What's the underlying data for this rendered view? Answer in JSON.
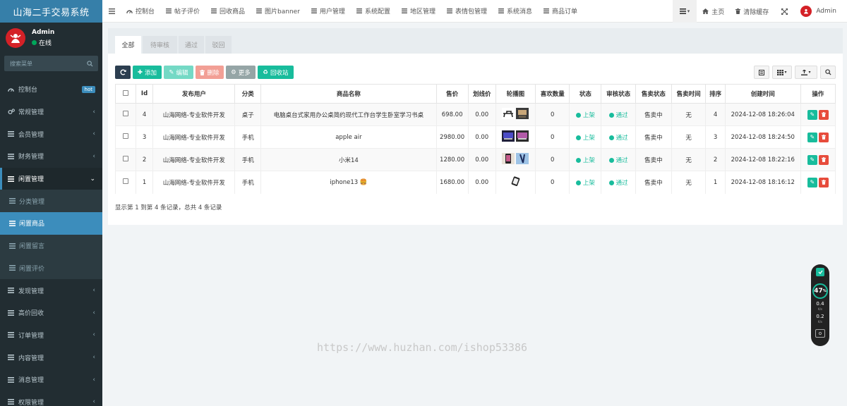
{
  "app": {
    "title": "山海二手交易系统"
  },
  "user": {
    "name": "Admin",
    "status": "在线"
  },
  "search": {
    "placeholder": "搜索菜单"
  },
  "sidebar": {
    "items": [
      {
        "label": "控制台",
        "badge": "hot",
        "icon": "dashboard-icon"
      },
      {
        "label": "常规管理",
        "icon": "cogs-icon"
      },
      {
        "label": "会员管理",
        "icon": "list-icon"
      },
      {
        "label": "财务管理",
        "icon": "list-icon"
      },
      {
        "label": "闲置管理",
        "icon": "list-icon",
        "open": true,
        "children": [
          {
            "label": "分类管理"
          },
          {
            "label": "闲置商品",
            "active": true
          },
          {
            "label": "闲置留言"
          },
          {
            "label": "闲置评价"
          }
        ]
      },
      {
        "label": "发现管理",
        "icon": "list-icon"
      },
      {
        "label": "高价回收",
        "icon": "list-icon"
      },
      {
        "label": "订单管理",
        "icon": "list-icon"
      },
      {
        "label": "内容管理",
        "icon": "list-icon"
      },
      {
        "label": "消息管理",
        "icon": "list-icon"
      },
      {
        "label": "权限管理",
        "icon": "list-icon"
      }
    ]
  },
  "header": {
    "nav": [
      "控制台",
      "帖子评价",
      "回收商品",
      "图片banner",
      "用户管理",
      "系统配置",
      "地区管理",
      "表情包管理",
      "系统消息",
      "商品订单"
    ],
    "right": {
      "home": "主页",
      "clear_cache": "清除缓存",
      "user": "Admin"
    }
  },
  "tabs": [
    "全部",
    "待审核",
    "通过",
    "驳回"
  ],
  "toolbar": {
    "add": "添加",
    "edit": "编辑",
    "delete": "删除",
    "more": "更多",
    "recycle": "回收站"
  },
  "table": {
    "columns": [
      "Id",
      "发布用户",
      "分类",
      "商品名称",
      "售价",
      "划线价",
      "轮播图",
      "喜欢数量",
      "状态",
      "审核状态",
      "售卖状态",
      "售卖时间",
      "排序",
      "创建时间",
      "操作"
    ],
    "rows": [
      {
        "id": "4",
        "user": "山海网络-专业软件开发",
        "category": "桌子",
        "name": "电脑桌台式家用办公桌简约现代工作台学生卧室学习书桌",
        "price": "698.00",
        "orig": "0.00",
        "likes": "0",
        "status": "上架",
        "audit": "通过",
        "sale_status": "售卖中",
        "sale_time": "无",
        "sort": "4",
        "created": "2024-12-08 18:26:04"
      },
      {
        "id": "3",
        "user": "山海网络-专业软件开发",
        "category": "手机",
        "name": "apple air",
        "price": "2980.00",
        "orig": "0.00",
        "likes": "0",
        "status": "上架",
        "audit": "通过",
        "sale_status": "售卖中",
        "sale_time": "无",
        "sort": "3",
        "created": "2024-12-08 18:24:50"
      },
      {
        "id": "2",
        "user": "山海网络-专业软件开发",
        "category": "手机",
        "name": "小米14",
        "price": "1280.00",
        "orig": "0.00",
        "likes": "0",
        "status": "上架",
        "audit": "通过",
        "sale_status": "售卖中",
        "sale_time": "无",
        "sort": "2",
        "created": "2024-12-08 18:22:16"
      },
      {
        "id": "1",
        "user": "山海网络-专业软件开发",
        "category": "手机",
        "name": "iphone13 🍔",
        "price": "1680.00",
        "orig": "0.00",
        "likes": "0",
        "status": "上架",
        "audit": "通过",
        "sale_status": "售卖中",
        "sale_time": "无",
        "sort": "1",
        "created": "2024-12-08 18:16:12"
      }
    ]
  },
  "pagination": {
    "info": "显示第 1 到第 4 条记录，总共 4 条记录"
  },
  "watermark": "https://www.huzhan.com/ishop53386",
  "widget": {
    "percent": "47",
    "percent_unit": "%",
    "up": "0.4",
    "down": "0.2",
    "rate_unit": "K/s"
  },
  "colors": {
    "sidebar": "#222d32",
    "accent": "#3c8dbc",
    "primary": "#2c3e50",
    "success": "#18bc9c",
    "danger": "#e74c3c",
    "header_logo": "#367fa9"
  }
}
